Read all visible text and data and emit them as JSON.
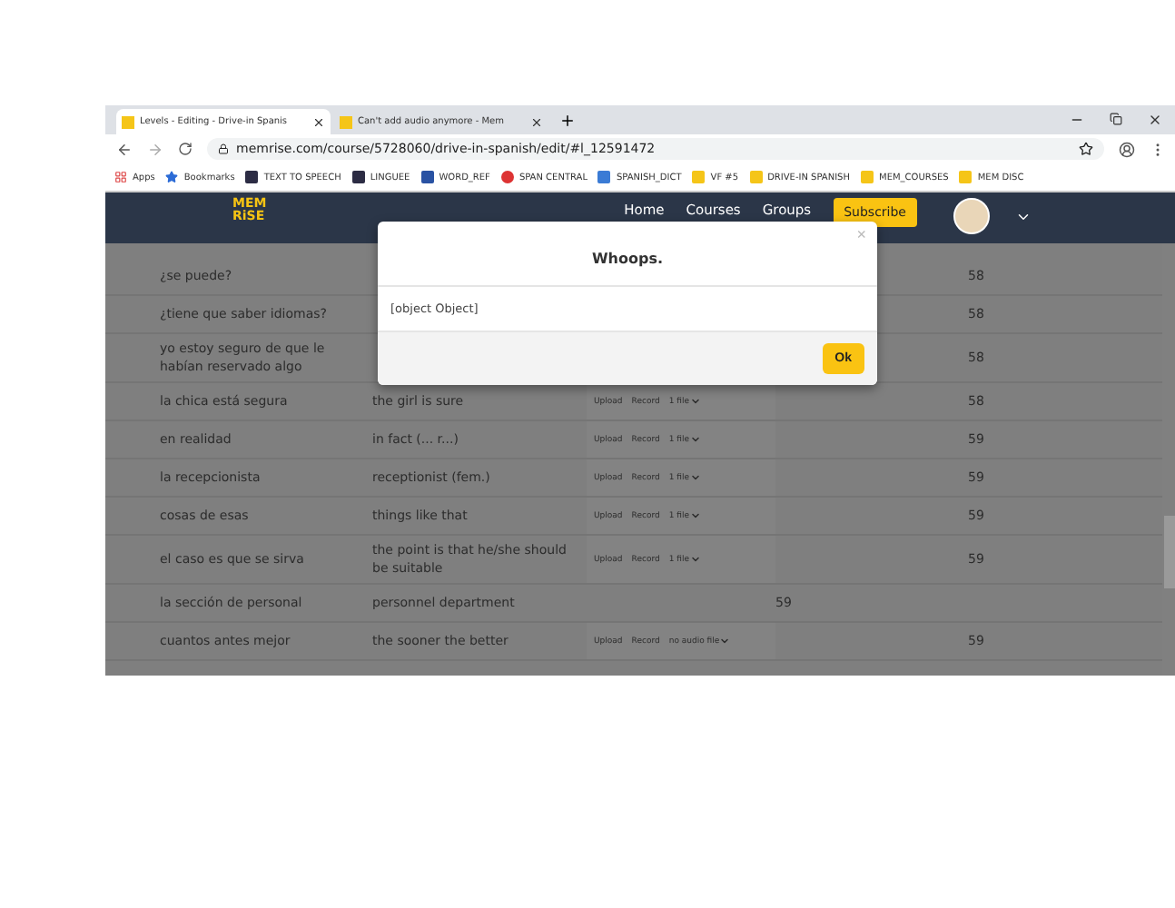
{
  "tabs": [
    {
      "label": "Levels - Editing - Drive-in Spanis",
      "selected": true
    },
    {
      "label": "Can't add audio anymore - Mem",
      "selected": false
    }
  ],
  "address": "memrise.com/course/5728060/drive-in-spanish/edit/#l_12591472",
  "bookmarks": [
    {
      "label": "Apps",
      "kind": "apps"
    },
    {
      "label": "Bookmarks",
      "kind": "star"
    },
    {
      "label": "TEXT TO SPEECH",
      "kind": "dark"
    },
    {
      "label": "LINGUEE",
      "kind": "dark"
    },
    {
      "label": "WORD_REF",
      "kind": "word"
    },
    {
      "label": "SPAN CENTRAL",
      "kind": "ring"
    },
    {
      "label": "SPANISH_DICT",
      "kind": "blue"
    },
    {
      "label": "VF #5",
      "kind": "yellow"
    },
    {
      "label": "DRIVE-IN SPANISH",
      "kind": "yellow"
    },
    {
      "label": "MEM_COURSES",
      "kind": "yellow"
    },
    {
      "label": "MEM DISC",
      "kind": "yellow"
    }
  ],
  "nav": {
    "logo_top": "MEM",
    "logo_bottom": "RiSE",
    "links": [
      "Home",
      "Courses",
      "Groups"
    ],
    "subscribe": "Subscribe"
  },
  "rows": [
    {
      "kind": "audio",
      "spanish": "¿se puede?",
      "level": "58"
    },
    {
      "kind": "audio",
      "spanish": "¿tiene que saber idiomas?",
      "level": "58"
    },
    {
      "kind": "audio",
      "spanish": "yo estoy seguro de que le habían reservado algo",
      "level": "58"
    },
    {
      "kind": "audio",
      "spanish": "la chica está segura",
      "english": "the girl is sure",
      "audio": {
        "upload": "Upload",
        "record": "Record",
        "files": "1 file"
      },
      "level": "58"
    },
    {
      "kind": "audio",
      "spanish": "en realidad",
      "english": "in fact (... r...)",
      "audio": {
        "upload": "Upload",
        "record": "Record",
        "files": "1 file"
      },
      "level": "59"
    },
    {
      "kind": "audio",
      "spanish": "la recepcionista",
      "english": "receptionist (fem.)",
      "audio": {
        "upload": "Upload",
        "record": "Record",
        "files": "1 file"
      },
      "level": "59"
    },
    {
      "kind": "audio",
      "spanish": "cosas de esas",
      "english": "things like that",
      "audio": {
        "upload": "Upload",
        "record": "Record",
        "files": "1 file"
      },
      "level": "59"
    },
    {
      "kind": "audio",
      "spanish": "el caso es que se sirva",
      "english": "the point is that he/she should be suitable",
      "audio": {
        "upload": "Upload",
        "record": "Record",
        "files": "1 file"
      },
      "level": "59"
    },
    {
      "kind": "plain",
      "spanish": "la sección de personal",
      "english": "personnel department",
      "level": "59"
    },
    {
      "kind": "audio",
      "spanish": "cuantos antes mejor",
      "english": "the sooner the better",
      "audio": {
        "upload": "Upload",
        "record": "Record",
        "files": "no audio file"
      },
      "level": "59"
    }
  ],
  "dialog": {
    "title": "Whoops.",
    "close": "×",
    "message": "[object Object]",
    "ok": "Ok"
  }
}
